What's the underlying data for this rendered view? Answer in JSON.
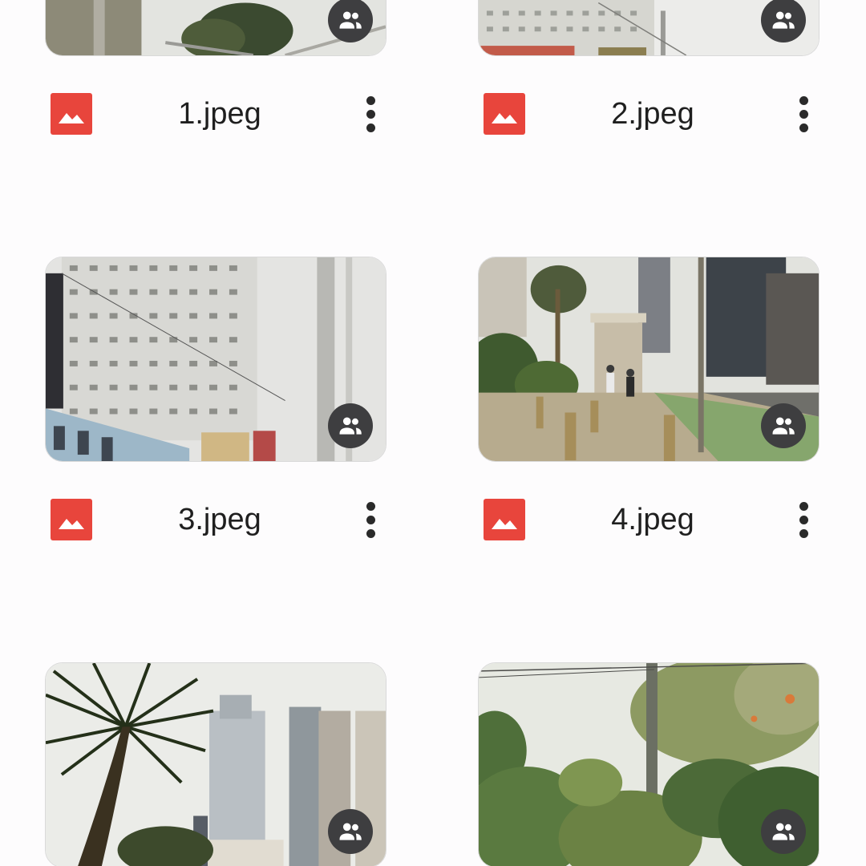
{
  "files": [
    {
      "name": "1.jpeg",
      "shared_icon": "people-icon",
      "type_icon": "image-file-icon"
    },
    {
      "name": "2.jpeg",
      "shared_icon": "people-icon",
      "type_icon": "image-file-icon"
    },
    {
      "name": "3.jpeg",
      "shared_icon": "people-icon",
      "type_icon": "image-file-icon"
    },
    {
      "name": "4.jpeg",
      "shared_icon": "people-icon",
      "type_icon": "image-file-icon"
    },
    {
      "name": "",
      "shared_icon": "people-icon",
      "type_icon": "image-file-icon"
    },
    {
      "name": "",
      "shared_icon": "people-icon",
      "type_icon": "image-file-icon"
    }
  ],
  "colors": {
    "image_type_red": "#e8453c",
    "badge_dark": "#3e3e40",
    "background": "#fdfcfd",
    "text": "#1f1f1f"
  },
  "icons": {
    "more": "more-vert-icon",
    "shared": "people-icon",
    "file_type": "image-file-icon"
  }
}
